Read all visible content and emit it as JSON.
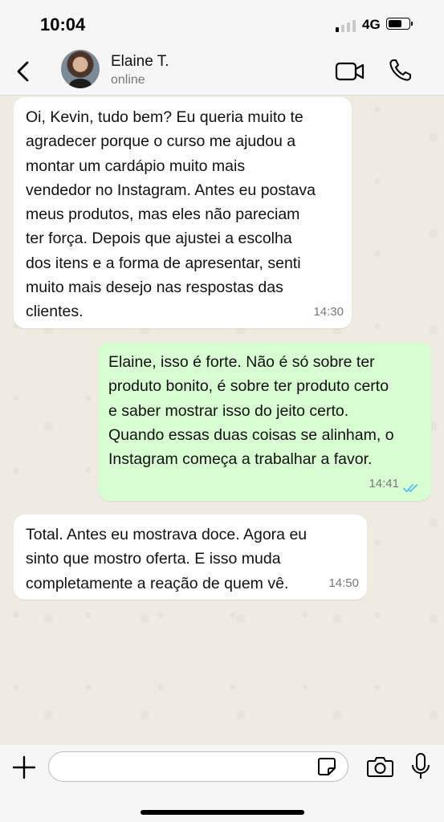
{
  "status_bar": {
    "time": "10:04",
    "network": "4G",
    "battery_level": 0.7
  },
  "header": {
    "back_icon": "chevron-left-icon",
    "contact_name": "Elaine T.",
    "contact_status": "online",
    "video_icon": "video-camera-icon",
    "call_icon": "phone-icon"
  },
  "messages": [
    {
      "direction": "incoming",
      "text": "Oi, Kevin, tudo bem? Eu queria muito te\nagradecer porque o curso me ajudou a\nmontar um cardápio muito mais\nvendedor no Instagram. Antes eu postava\nmeus produtos, mas eles não pareciam\nter força. Depois que ajustei a escolha\ndos itens e a forma de apresentar, senti\nmuito mais desejo nas respostas das\nclientes.",
      "time": "14:30"
    },
    {
      "direction": "outgoing",
      "text": "Elaine, isso é forte. Não é só sobre ter\nproduto bonito, é sobre ter produto certo\ne saber mostrar isso do jeito certo.\nQuando essas duas coisas se alinham, o\nInstagram começa a trabalhar a favor.",
      "time": "14:41",
      "read": true
    },
    {
      "direction": "incoming",
      "text": "Total. Antes eu mostrava doce. Agora eu\nsinto que mostro oferta. E isso muda\ncompletamente a reação de quem vê.",
      "time": "14:50"
    }
  ],
  "composer": {
    "placeholder": "",
    "icons": [
      "plus-icon",
      "sticker-icon",
      "camera-icon",
      "microphone-icon"
    ]
  },
  "colors": {
    "outgoing_bubble": "#d9fdd3",
    "incoming_bubble": "#ffffff",
    "read_ticks": "#53bdeb",
    "background": "#efeae2"
  }
}
